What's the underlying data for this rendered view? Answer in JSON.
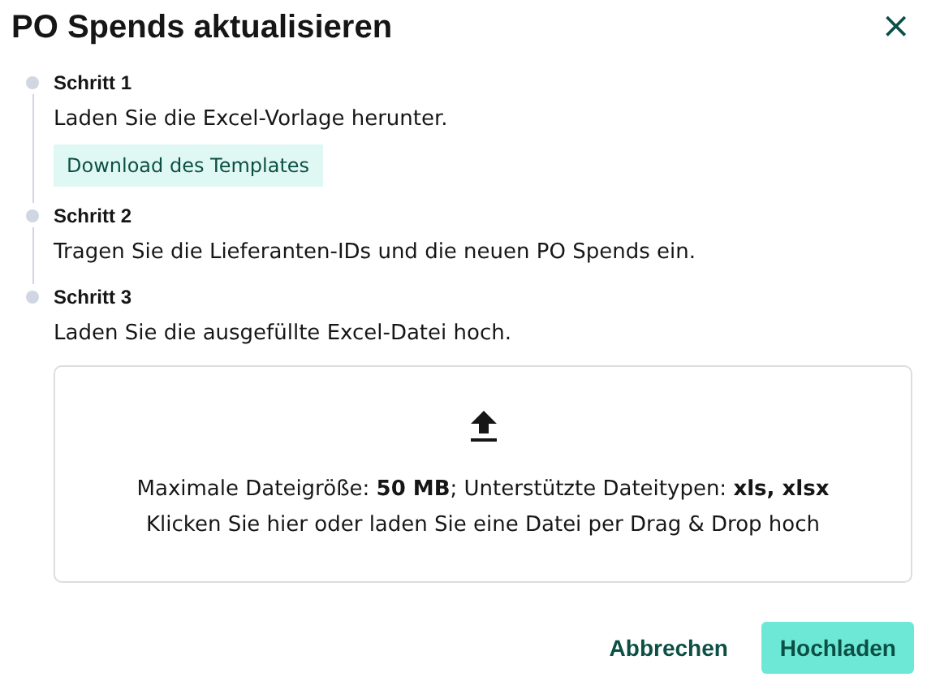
{
  "dialog": {
    "title": "PO Spends aktualisieren",
    "close": "×"
  },
  "steps": [
    {
      "label": "Schritt 1",
      "text": "Laden Sie die Excel-Vorlage herunter.",
      "button": "Download des Templates"
    },
    {
      "label": "Schritt 2",
      "text": "Tragen Sie die Lieferanten-IDs und die neuen PO Spends ein."
    },
    {
      "label": "Schritt 3",
      "text": "Laden Sie die ausgefüllte Excel-Datei hoch."
    }
  ],
  "dropzone": {
    "limits": "Maximale Dateigröße: **50 MB**; Unterstützte Dateitypen: **xls, xlsx**",
    "hint": "Klicken Sie hier oder laden Sie eine Datei per Drag & Drop hoch"
  },
  "buttons": [
    {
      "label": "Abbrechen",
      "kind": "secondary"
    },
    {
      "label": "Hochladen",
      "kind": "primary"
    }
  ]
}
